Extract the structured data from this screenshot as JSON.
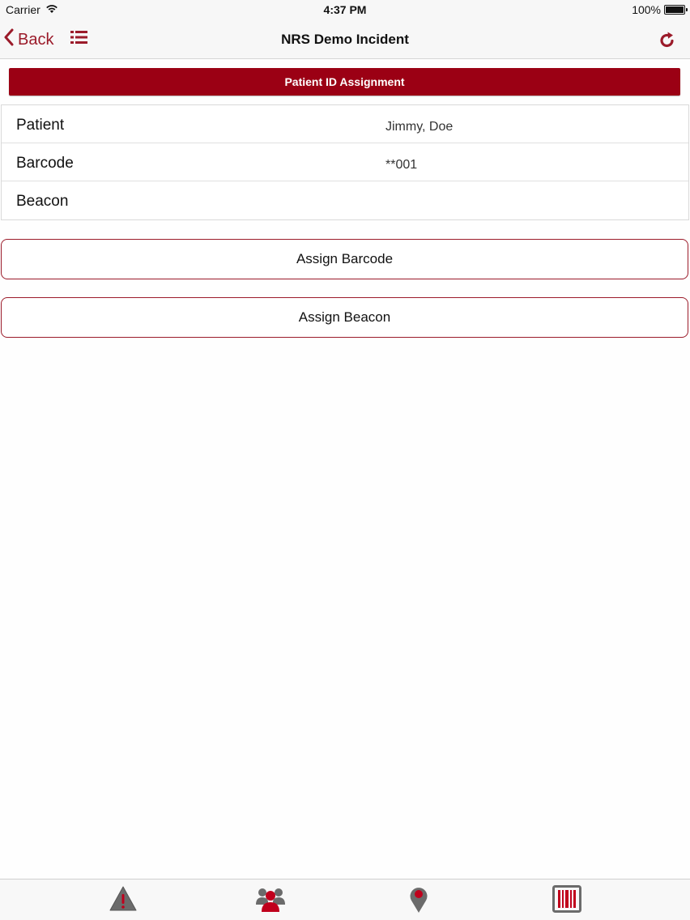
{
  "status_bar": {
    "carrier": "Carrier",
    "time": "4:37 PM",
    "battery": "100%"
  },
  "nav": {
    "back_label": "Back",
    "title": "NRS Demo Incident"
  },
  "section": {
    "title": "Patient ID Assignment"
  },
  "info_rows": [
    {
      "label": "Patient",
      "value": "Jimmy, Doe"
    },
    {
      "label": "Barcode",
      "value": "**001"
    },
    {
      "label": "Beacon",
      "value": ""
    }
  ],
  "actions": {
    "assign_barcode": "Assign Barcode",
    "assign_beacon": "Assign Beacon"
  },
  "tabs": [
    {
      "icon": "warning-icon"
    },
    {
      "icon": "people-icon"
    },
    {
      "icon": "location-pin-icon"
    },
    {
      "icon": "barcode-icon"
    }
  ],
  "colors": {
    "accent": "#9b1b2a",
    "header_bg": "#9b0014",
    "icon_gray": "#6b6b6b",
    "icon_red": "#c0001c"
  }
}
